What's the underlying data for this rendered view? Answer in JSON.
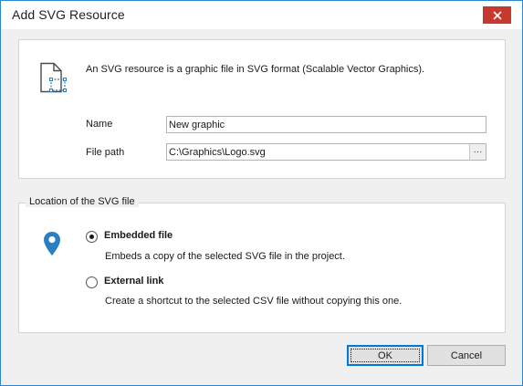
{
  "window": {
    "title": "Add SVG Resource",
    "accent_color": "#2b86d3",
    "close_color": "#c7382e"
  },
  "resource": {
    "description": "An SVG resource is a graphic file in SVG format (Scalable Vector Graphics).",
    "icon": "svg-file-icon",
    "name_label": "Name",
    "name_value": "New graphic",
    "path_label": "File path",
    "path_value": "C:\\Graphics\\Logo.svg",
    "browse_label": "···"
  },
  "location": {
    "group_title": "Location of the SVG file",
    "icon": "location-pin-icon",
    "icon_color": "#2a7fc0",
    "selected": "embedded",
    "options": [
      {
        "id": "embedded",
        "label": "Embedded file",
        "description": "Embeds a copy of the selected SVG file in the project."
      },
      {
        "id": "external",
        "label": "External link",
        "description": "Create a shortcut to the selected CSV file without copying this one."
      }
    ]
  },
  "buttons": {
    "ok": "OK",
    "cancel": "Cancel"
  }
}
